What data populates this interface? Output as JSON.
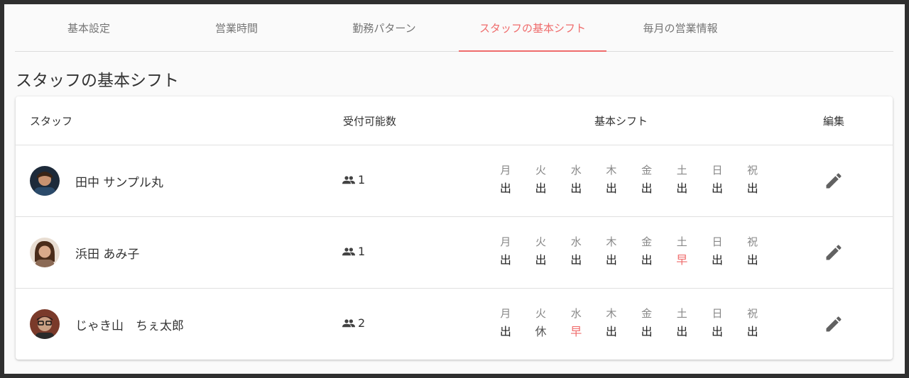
{
  "tabs": [
    {
      "label": "基本設定"
    },
    {
      "label": "営業時間"
    },
    {
      "label": "勤務パターン"
    },
    {
      "label": "スタッフの基本シフト",
      "active": true
    },
    {
      "label": "毎月の営業情報"
    }
  ],
  "page_title": "スタッフの基本シフト",
  "table": {
    "headers": {
      "staff": "スタッフ",
      "capacity": "受付可能数",
      "shift": "基本シフト",
      "edit": "編集"
    },
    "day_labels": [
      "月",
      "火",
      "水",
      "木",
      "金",
      "土",
      "日",
      "祝"
    ],
    "rows": [
      {
        "name": "田中 サンプル丸",
        "capacity": "1",
        "shifts": [
          "出",
          "出",
          "出",
          "出",
          "出",
          "出",
          "出",
          "出"
        ]
      },
      {
        "name": "浜田 あみ子",
        "capacity": "1",
        "shifts": [
          "出",
          "出",
          "出",
          "出",
          "出",
          "早",
          "出",
          "出"
        ]
      },
      {
        "name": "じゃき山　ちぇ太郎",
        "capacity": "2",
        "shifts": [
          "出",
          "休",
          "早",
          "出",
          "出",
          "出",
          "出",
          "出"
        ]
      }
    ]
  },
  "colors": {
    "accent": "#ef6c6c",
    "early_shift": "#ef6c6c",
    "icon": "#616161"
  },
  "icons": {
    "capacity": "people-icon",
    "edit": "pencil-icon"
  }
}
